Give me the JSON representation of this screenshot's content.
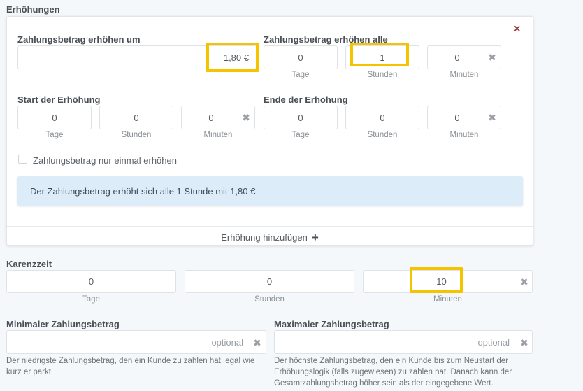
{
  "section_title": "Erhöhungen",
  "card": {
    "close_label": "×",
    "increase_by": {
      "label": "Zahlungsbetrag erhöhen um",
      "value": "1,80 €"
    },
    "increase_every": {
      "label": "Zahlungsbetrag erhöhen alle",
      "days": {
        "value": "0",
        "unit": "Tage"
      },
      "hours": {
        "value": "1",
        "unit": "Stunden"
      },
      "minutes": {
        "value": "0",
        "unit": "Minuten"
      }
    },
    "start": {
      "label": "Start der Erhöhung",
      "days": {
        "value": "0",
        "unit": "Tage"
      },
      "hours": {
        "value": "0",
        "unit": "Stunden"
      },
      "minutes": {
        "value": "0",
        "unit": "Minuten"
      }
    },
    "end": {
      "label": "Ende der Erhöhung",
      "days": {
        "value": "0",
        "unit": "Tage"
      },
      "hours": {
        "value": "0",
        "unit": "Stunden"
      },
      "minutes": {
        "value": "0",
        "unit": "Minuten"
      }
    },
    "once_checkbox_label": "Zahlungsbetrag nur einmal erhöhen",
    "info_text": "Der Zahlungsbetrag erhöht sich alle 1 Stunde mit 1,80 €",
    "add_label": "Erhöhung hinzufügen"
  },
  "grace": {
    "title": "Karenzzeit",
    "days": {
      "value": "0",
      "unit": "Tage"
    },
    "hours": {
      "value": "0",
      "unit": "Stunden"
    },
    "minutes": {
      "value": "10",
      "unit": "Minuten"
    }
  },
  "min_amount": {
    "title": "Minimaler Zahlungsbetrag",
    "placeholder": "optional",
    "help": "Der niedrigste Zahlungsbetrag, den ein Kunde zu zahlen hat, egal wie kurz er parkt."
  },
  "max_amount": {
    "title": "Maximaler Zahlungsbetrag",
    "placeholder": "optional",
    "help": "Der höchste Zahlungsbetrag, den ein Kunde bis zum Neustart der Erhöhungslogik (falls zugewiesen) zu zahlen hat. Danach kann der Gesamtzahlungsbetrag höher sein als der eingegebene Wert."
  },
  "clear_symbol": "✖",
  "colors": {
    "highlight": "#f5c400",
    "info_bg": "#dcecf8",
    "close": "#9e3b3b"
  }
}
